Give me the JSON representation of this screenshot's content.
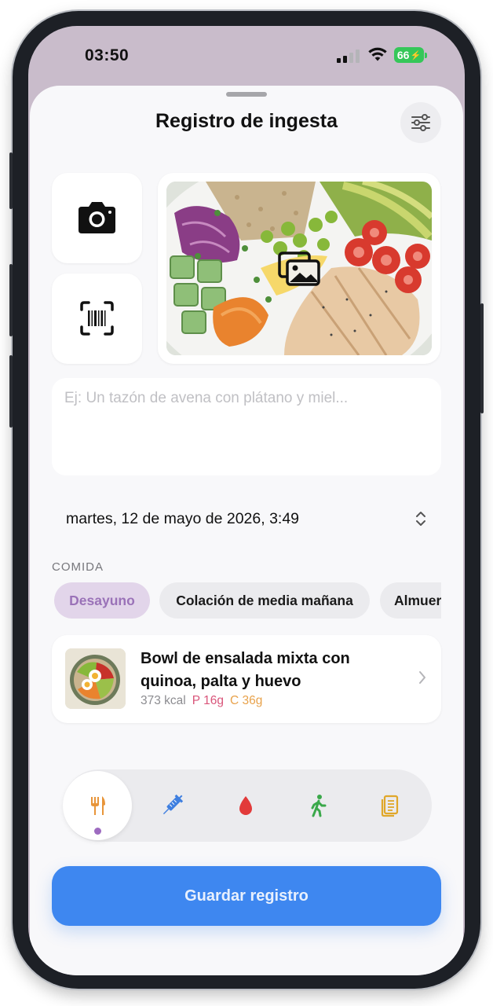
{
  "status_bar": {
    "time": "03:50",
    "battery": "66"
  },
  "header": {
    "title": "Registro de ingesta"
  },
  "input": {
    "placeholder": "Ej: Un tazón de avena con plátano y miel...",
    "value": ""
  },
  "datetime": {
    "value": "martes, 12 de mayo de 2026, 3:49"
  },
  "meal_section": {
    "label": "COMIDA",
    "chips": [
      {
        "label": "Desayuno",
        "selected": true
      },
      {
        "label": "Colación de media mañana",
        "selected": false
      },
      {
        "label": "Almuerzo",
        "selected": false
      }
    ]
  },
  "food_item": {
    "name": "Bowl de ensalada mixta con quinoa, palta y huevo",
    "kcal": "373 kcal",
    "protein": "P 16g",
    "carbs": "C 36g"
  },
  "tabs": [
    {
      "icon": "fork-knife-icon",
      "color": "#e8953a",
      "active": true
    },
    {
      "icon": "syringe-icon",
      "color": "#3f7fe0",
      "active": false
    },
    {
      "icon": "blood-drop-icon",
      "color": "#e23a3a",
      "active": false
    },
    {
      "icon": "walking-person-icon",
      "color": "#3aa84a",
      "active": false
    },
    {
      "icon": "notes-icon",
      "color": "#e0a72a",
      "active": false
    }
  ],
  "save_button": {
    "label": "Guardar registro"
  },
  "colors": {
    "accent": "#3e87f0",
    "selected_chip": "#e2d5ea",
    "selected_chip_text": "#9a72b8",
    "status_bg": "#c9bccb"
  }
}
